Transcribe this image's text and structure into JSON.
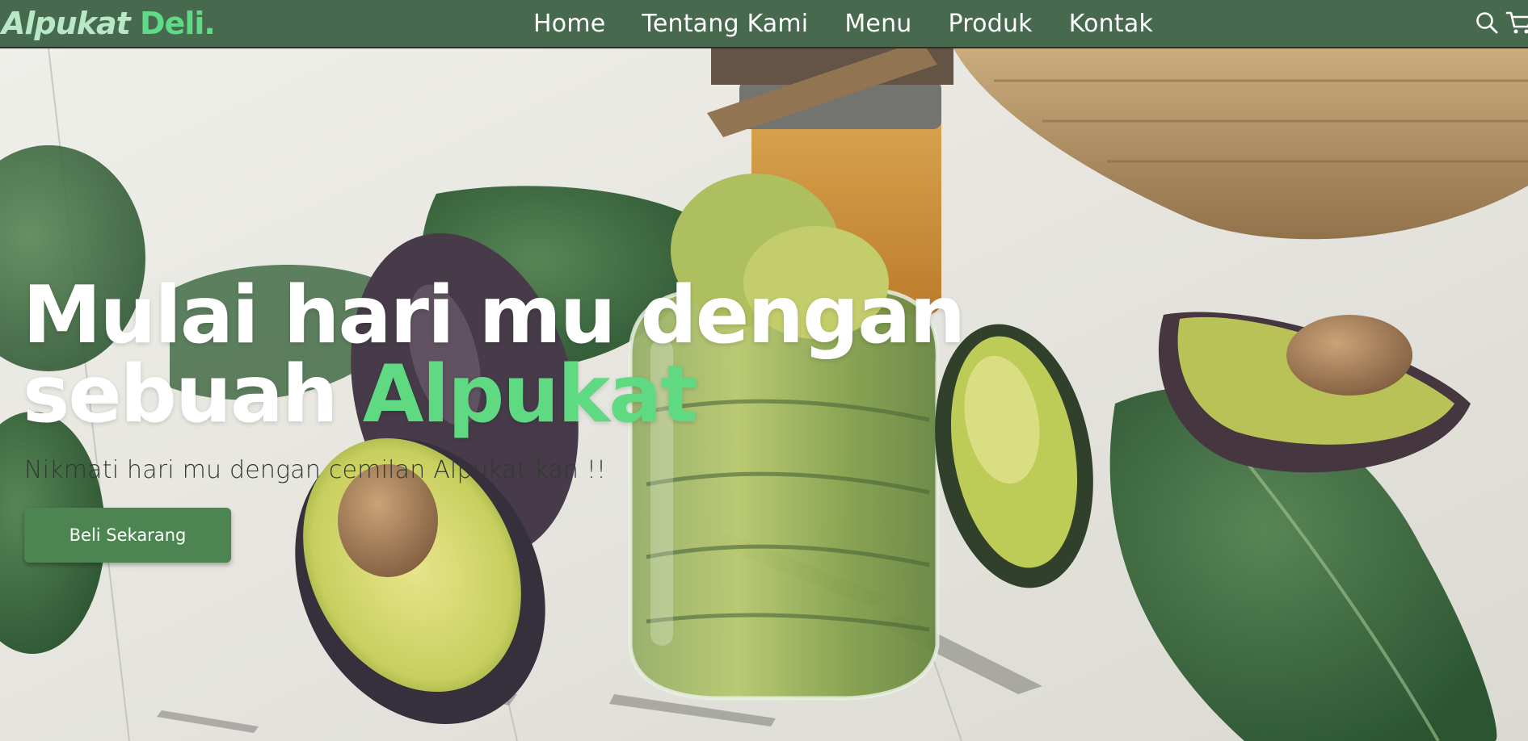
{
  "brand": {
    "name": "Alpukat",
    "suffix": "Deli."
  },
  "nav": {
    "items": [
      {
        "label": "Home"
      },
      {
        "label": "Tentang Kami"
      },
      {
        "label": "Menu"
      },
      {
        "label": "Produk"
      },
      {
        "label": "Kontak"
      }
    ],
    "icons": [
      "search-icon",
      "cart-icon"
    ]
  },
  "hero": {
    "headline_line1": "Mulai hari mu dengan",
    "headline_line2_prefix": "sebuah",
    "headline_line2_accent": "Alpukat",
    "subtext": "Nikmati hari mu dengan cemilan Alpukat kan !!",
    "cta_label": "Beli Sekarang"
  },
  "colors": {
    "navbar": "#476a4f",
    "brand_light": "#b8e8c6",
    "accent": "#5fd982",
    "cta": "#4c8552",
    "headline": "#ffffff"
  }
}
